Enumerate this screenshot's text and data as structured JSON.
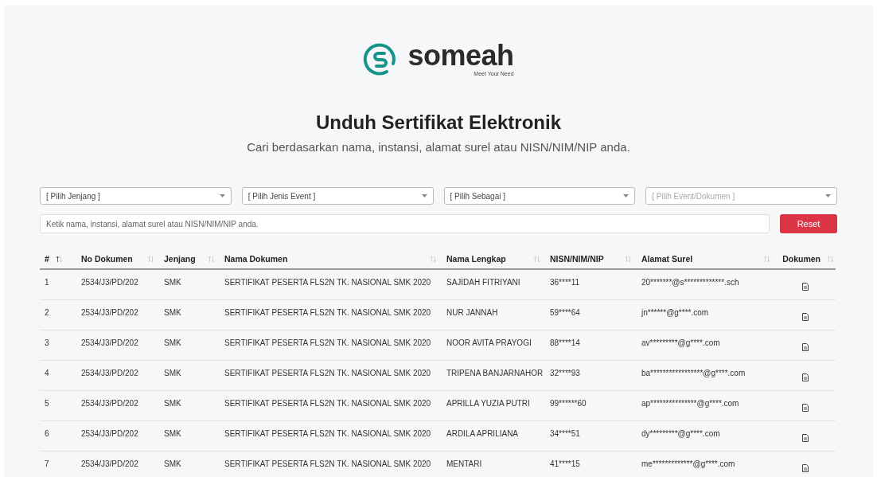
{
  "logo": {
    "name": "someah",
    "tagline": "Meet Your Need"
  },
  "title": "Unduh Sertifikat Elektronik",
  "subtitle": "Cari berdasarkan nama, instansi, alamat surel atau NISN/NIM/NIP anda.",
  "filters": [
    {
      "placeholder": "[ Pilih Jenjang ]",
      "disabled": false
    },
    {
      "placeholder": "[ Pilih Jenis Event ]",
      "disabled": false
    },
    {
      "placeholder": "[ Pilih Sebagai ]",
      "disabled": false
    },
    {
      "placeholder": "[ Pilih Event/Dokumen ]",
      "disabled": true
    }
  ],
  "search": {
    "placeholder": "Ketik nama, instansi, alamat surel atau NISN/NIM/NIP anda."
  },
  "reset_button": "Reset",
  "table": {
    "columns": [
      {
        "label": "#",
        "sorted": true
      },
      {
        "label": "No Dokumen",
        "sorted": false
      },
      {
        "label": "Jenjang",
        "sorted": false
      },
      {
        "label": "Nama Dokumen",
        "sorted": false
      },
      {
        "label": "Nama Lengkap",
        "sorted": false
      },
      {
        "label": "NISN/NIM/NIP",
        "sorted": false
      },
      {
        "label": "Alamat Surel",
        "sorted": false
      },
      {
        "label": "Dokumen",
        "sorted": false
      }
    ],
    "rows": [
      {
        "no": "1",
        "doc_no": "2534/J3/PD/202",
        "level": "SMK",
        "doc_name": "SERTIFIKAT PESERTA FLS2N TK. NASIONAL SMK 2020",
        "full_name": "SAJIDAH FITRIYANI",
        "id": "36****11",
        "email": "20*******@s*************.sch"
      },
      {
        "no": "2",
        "doc_no": "2534/J3/PD/202",
        "level": "SMK",
        "doc_name": "SERTIFIKAT PESERTA FLS2N TK. NASIONAL SMK 2020",
        "full_name": "NUR JANNAH",
        "id": "59****64",
        "email": "jn******@g****.com"
      },
      {
        "no": "3",
        "doc_no": "2534/J3/PD/202",
        "level": "SMK",
        "doc_name": "SERTIFIKAT PESERTA FLS2N TK. NASIONAL SMK 2020",
        "full_name": "NOOR AVITA PRAYOGI",
        "id": "88****14",
        "email": "av*********@g****.com"
      },
      {
        "no": "4",
        "doc_no": "2534/J3/PD/202",
        "level": "SMK",
        "doc_name": "SERTIFIKAT PESERTA FLS2N TK. NASIONAL SMK 2020",
        "full_name": "TRIPENA BANJARNAHOR",
        "id": "32****93",
        "email": "ba*****************@g****.com"
      },
      {
        "no": "5",
        "doc_no": "2534/J3/PD/202",
        "level": "SMK",
        "doc_name": "SERTIFIKAT PESERTA FLS2N TK. NASIONAL SMK 2020",
        "full_name": "APRILLA YUZIA PUTRI",
        "id": "99******60",
        "email": "ap***************@g****.com"
      },
      {
        "no": "6",
        "doc_no": "2534/J3/PD/202",
        "level": "SMK",
        "doc_name": "SERTIFIKAT PESERTA FLS2N TK. NASIONAL SMK 2020",
        "full_name": "ARDILA APRILIANA",
        "id": "34****51",
        "email": "dy*********@g****.com"
      },
      {
        "no": "7",
        "doc_no": "2534/J3/PD/202",
        "level": "SMK",
        "doc_name": "SERTIFIKAT PESERTA FLS2N TK. NASIONAL SMK 2020",
        "full_name": "MENTARI",
        "id": "41****15",
        "email": "me*************@g****.com"
      }
    ]
  }
}
